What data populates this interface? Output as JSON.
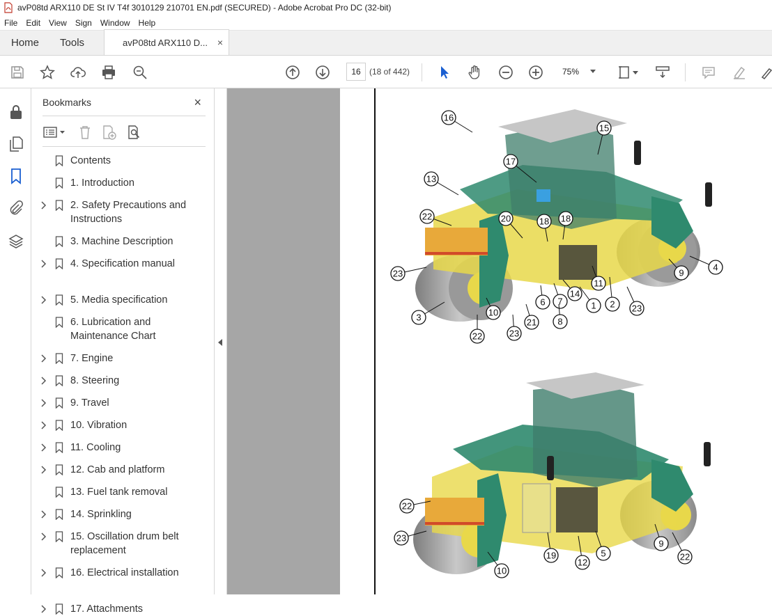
{
  "window": {
    "title": "avP08td ARX110 DE St IV T4f 3010129 210701 EN.pdf (SECURED) - Adobe Acrobat Pro DC (32-bit)"
  },
  "menu": [
    "File",
    "Edit",
    "View",
    "Sign",
    "Window",
    "Help"
  ],
  "tabs": {
    "home": "Home",
    "tools": "Tools",
    "doc": "avP08td ARX110 D...",
    "doc_close": "×"
  },
  "toolbar": {
    "page_number": "16",
    "page_count": "(18 of 442)",
    "zoom": "75%"
  },
  "bookmarks": {
    "title": "Bookmarks",
    "close": "×",
    "items": [
      {
        "label": "Contents",
        "expandable": false
      },
      {
        "label": "1. Introduction",
        "expandable": false
      },
      {
        "label": "2. Safety Precautions and Instructions",
        "expandable": true
      },
      {
        "label": "3. Machine Description",
        "expandable": false
      },
      {
        "label": "4. Specification manual",
        "expandable": true
      },
      {
        "label": "5. Media specification",
        "expandable": true
      },
      {
        "label": "6. Lubrication and Maintenance Chart",
        "expandable": false
      },
      {
        "label": "7. Engine",
        "expandable": true
      },
      {
        "label": "8. Steering",
        "expandable": true
      },
      {
        "label": "9. Travel",
        "expandable": true
      },
      {
        "label": "10. Vibration",
        "expandable": true
      },
      {
        "label": "11. Cooling",
        "expandable": true
      },
      {
        "label": "12. Cab and platform",
        "expandable": true
      },
      {
        "label": "13. Fuel tank removal",
        "expandable": false
      },
      {
        "label": "14. Sprinkling",
        "expandable": true
      },
      {
        "label": "15. Oscillation drum belt replacement",
        "expandable": true
      },
      {
        "label": "16. Electrical installation",
        "expandable": true
      },
      {
        "label": "17. Attachments",
        "expandable": true
      }
    ]
  },
  "figure_top": {
    "callouts": [
      "16",
      "15",
      "17",
      "13",
      "22",
      "20",
      "18",
      "18",
      "4",
      "9",
      "23",
      "11",
      "14",
      "1",
      "2",
      "23",
      "7",
      "6",
      "3",
      "10",
      "21",
      "8",
      "22",
      "23"
    ]
  },
  "figure_bottom": {
    "callouts": [
      "22",
      "23",
      "19",
      "12",
      "5",
      "9",
      "22",
      "10"
    ]
  },
  "colors": {
    "machine_yellow": "#e8d84a",
    "machine_green": "#2f8a6e",
    "cab_glass": "#3f7d6b",
    "drum_grey": "#9a9a9a",
    "roof_grey": "#c6c6c6",
    "viewer_bg": "#a6a6a6"
  }
}
